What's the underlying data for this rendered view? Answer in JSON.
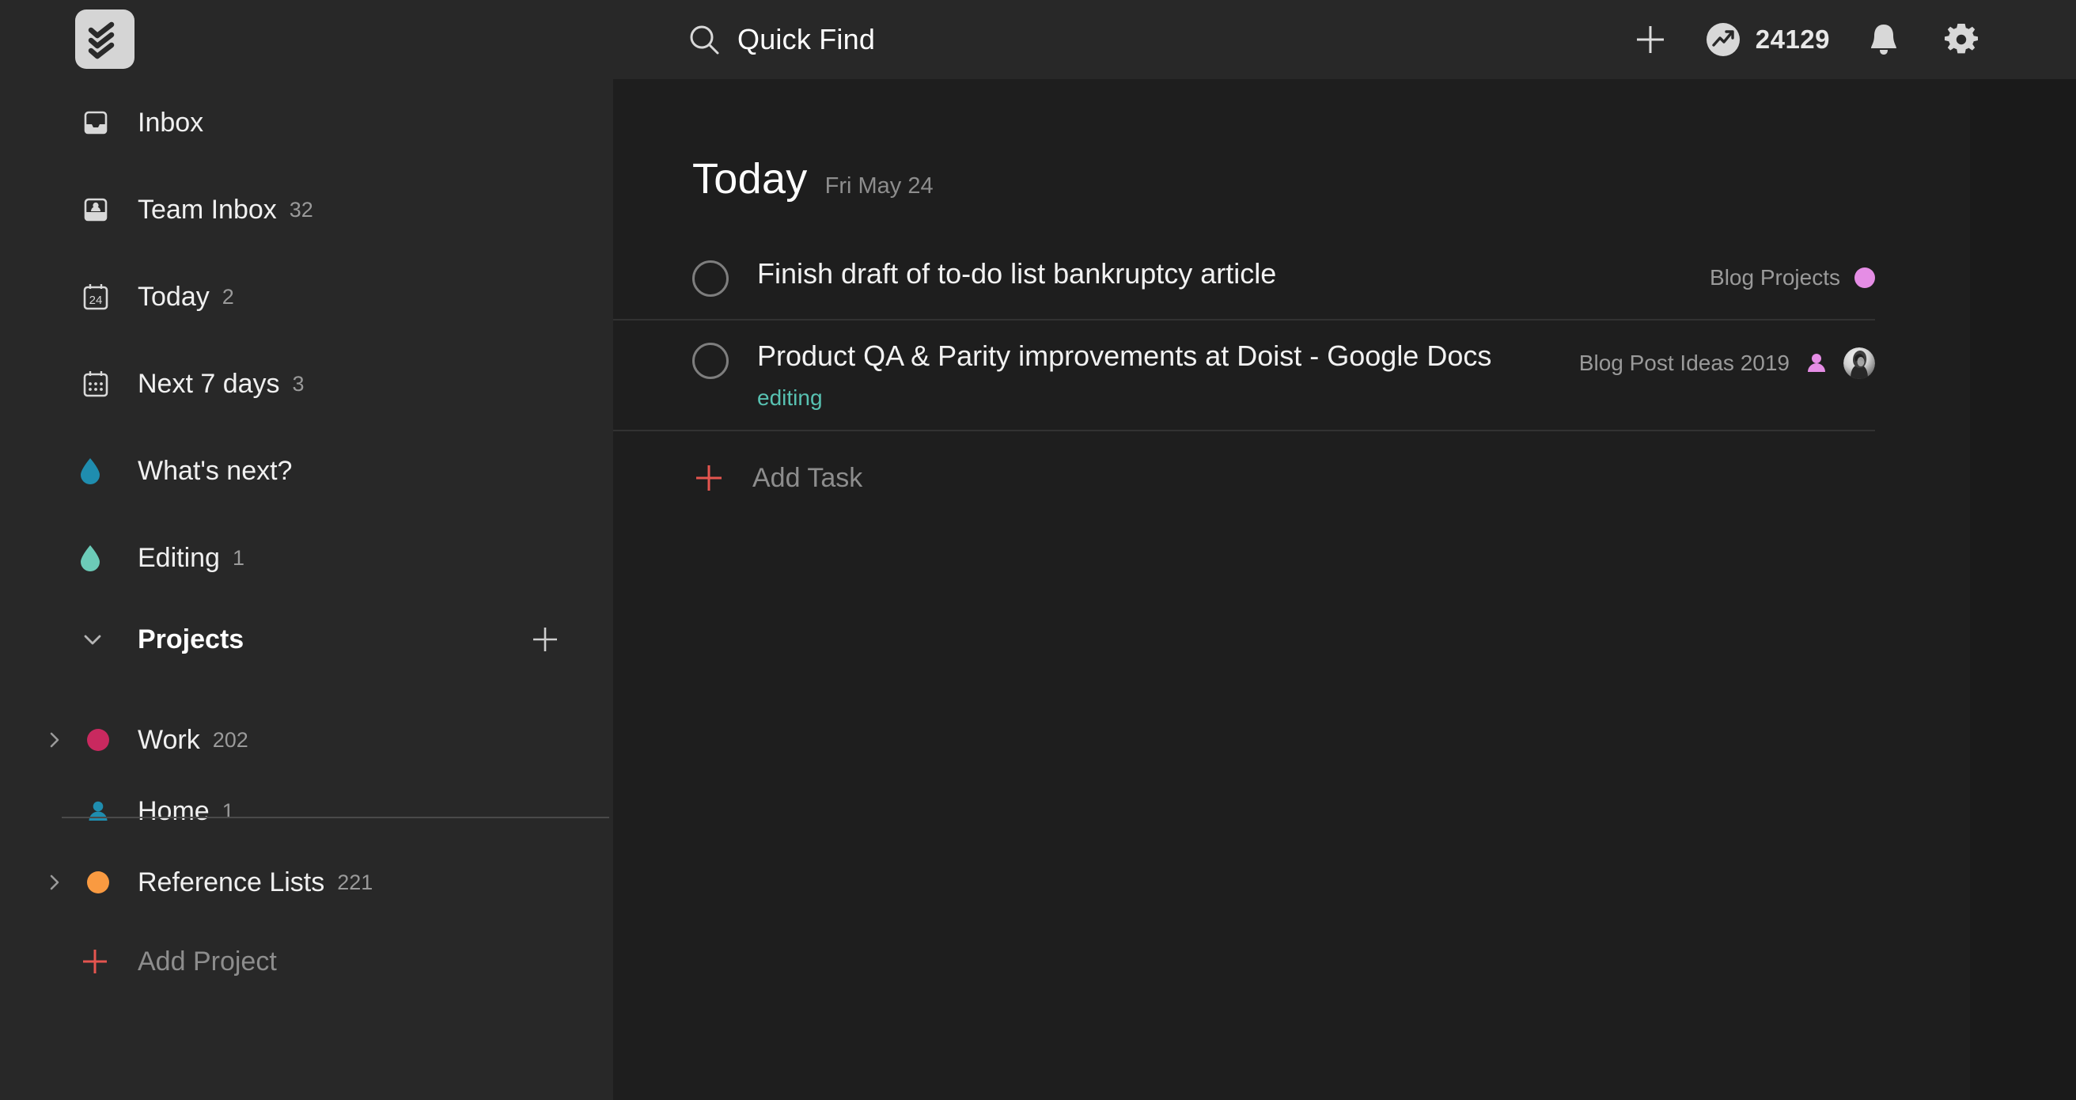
{
  "app": {
    "name": "Todoist",
    "logo_icon": "todoist-logo-icon"
  },
  "header": {
    "search": {
      "icon": "search-icon",
      "label": "Quick Find",
      "placeholder": "Quick Find"
    },
    "actions": {
      "add_icon": "plus-icon",
      "karma_icon": "karma-trend-icon",
      "karma_count": "24129",
      "notifications_icon": "bell-icon",
      "settings_icon": "gear-icon"
    }
  },
  "sidebar": {
    "nav": [
      {
        "label": "Inbox",
        "count": "",
        "icon": "inbox-icon",
        "type": "inbox"
      },
      {
        "label": "Team Inbox",
        "count": "32",
        "icon": "team-inbox-icon",
        "type": "team-inbox"
      },
      {
        "label": "Today",
        "count": "2",
        "icon": "calendar-24-icon",
        "type": "today",
        "day": "24"
      },
      {
        "label": "Next 7 days",
        "count": "3",
        "icon": "calendar-week-icon",
        "type": "next7"
      }
    ],
    "filters": [
      {
        "label": "What's next?",
        "count": "",
        "icon": "filter-droplet-icon",
        "color": "#1f8daf"
      },
      {
        "label": "Editing",
        "count": "1",
        "icon": "filter-droplet-icon",
        "color": "#6ccbb8"
      }
    ],
    "projects_section": {
      "title": "Projects",
      "collapse_icon": "chevron-down-icon",
      "add_icon": "plus-icon"
    },
    "projects": [
      {
        "label": "Work",
        "count": "202",
        "color": "#c9295f",
        "expandable": true,
        "icon": "project-dot-icon",
        "chevron": "chevron-right-icon"
      },
      {
        "label": "Home",
        "count": "1",
        "color": "#1f8daf",
        "expandable": false,
        "icon": "shared-project-icon",
        "chevron": ""
      },
      {
        "label": "Reference Lists",
        "count": "221",
        "color": "#f99a41",
        "expandable": true,
        "icon": "project-dot-icon",
        "chevron": "chevron-right-icon"
      }
    ],
    "add_project": {
      "label": "Add Project",
      "icon": "plus-icon",
      "color": "#e5554f"
    }
  },
  "main": {
    "title": "Today",
    "date": "Fri May 24",
    "tasks": [
      {
        "title": "Finish draft of to-do list bankruptcy article",
        "label": "",
        "project": "Blog Projects",
        "project_color": "#e58de5",
        "project_icon": "project-dot-icon",
        "checkbox_icon": "task-checkbox-icon",
        "has_avatar": false
      },
      {
        "title": "Product QA & Parity improvements at Doist - Google Docs",
        "label": "editing",
        "label_color": "#58c2b2",
        "project": "Blog Post Ideas 2019",
        "project_color": "#e58de5",
        "project_icon": "shared-project-icon",
        "checkbox_icon": "task-checkbox-icon",
        "has_avatar": true,
        "avatar_icon": "user-avatar-icon"
      }
    ],
    "add_task": {
      "label": "Add Task",
      "icon": "plus-icon",
      "color": "#e5554f"
    }
  },
  "colors": {
    "header_bg": "#282828",
    "sidebar_bg": "#282828",
    "main_bg": "#1e1e1e",
    "page_bg": "#1a1a1a",
    "accent_red": "#e5554f",
    "text_primary": "#f0f0f0",
    "text_muted": "#9a9a9a"
  }
}
